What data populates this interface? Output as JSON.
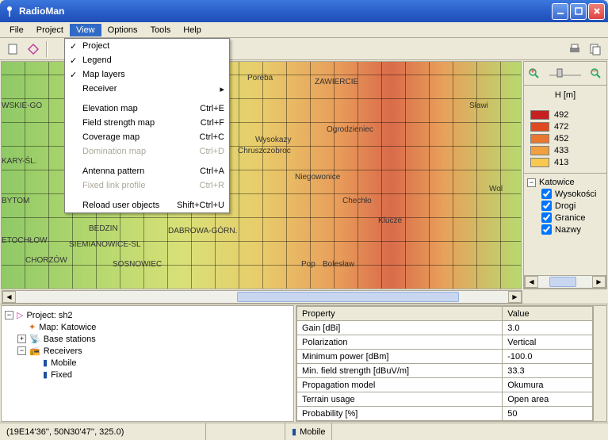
{
  "window": {
    "title": "RadioMan"
  },
  "menubar": {
    "file": "File",
    "project": "Project",
    "view": "View",
    "options": "Options",
    "tools": "Tools",
    "help": "Help"
  },
  "viewMenu": {
    "project": "Project",
    "legend": "Legend",
    "mapLayers": "Map layers",
    "receiver": "Receiver",
    "elevationMap": "Elevation map",
    "elevationMapKey": "Ctrl+E",
    "fieldStrength": "Field strength map",
    "fieldStrengthKey": "Ctrl+F",
    "coverage": "Coverage map",
    "coverageKey": "Ctrl+C",
    "domination": "Domination map",
    "dominationKey": "Ctrl+D",
    "antenna": "Antenna pattern",
    "antennaKey": "Ctrl+A",
    "fixedLink": "Fixed link profile",
    "fixedLinkKey": "Ctrl+R",
    "reload": "Reload user objects",
    "reloadKey": "Shift+Ctrl+U"
  },
  "map": {
    "labels": {
      "wskie": "WSKIE-GO",
      "kary": "KARY-ŚL.",
      "bytom": "BYTOM",
      "etochlow": "ETOCHŁOW",
      "chorzow": "CHORZÓW",
      "bedzin": "BEDZIN",
      "siemianowice": "SIEMIANOWICE-SL",
      "sosnowiec": "SOSNOWIEC",
      "dabrowa": "DABROWA-GÓRN.",
      "poreba": "Poreba",
      "zawiercie": "ZAWIERCIE",
      "ogrodzieniec": "Ogrodzieniec",
      "wysokazy": "Wysokazy",
      "chruszczobroc": "Chruszczobroc",
      "niegowonice": "Niegowonice",
      "chechlo": "Chechło",
      "klucze": "Klucze",
      "boleslaw": "Bolesław",
      "pop": "Pop",
      "wol": "Wol",
      "slawi": "Sławi"
    }
  },
  "legend": {
    "title": "H [m]",
    "items": [
      {
        "color": "#c62020",
        "value": "492"
      },
      {
        "color": "#e04a20",
        "value": "472"
      },
      {
        "color": "#e87830",
        "value": "452"
      },
      {
        "color": "#f0a040",
        "value": "433"
      },
      {
        "color": "#f8c850",
        "value": "413"
      }
    ]
  },
  "layerTree": {
    "root": "Katowice",
    "children": [
      {
        "label": "Wysokości",
        "checked": true
      },
      {
        "label": "Drogi",
        "checked": true
      },
      {
        "label": "Granice",
        "checked": true
      },
      {
        "label": "Nazwy",
        "checked": true
      }
    ]
  },
  "projectTree": {
    "root": "Project: sh2",
    "map": "Map: Katowice",
    "baseStations": "Base stations",
    "receivers": "Receivers",
    "mobile": "Mobile",
    "fixed": "Fixed"
  },
  "properties": {
    "headerProp": "Property",
    "headerVal": "Value",
    "rows": [
      {
        "prop": "Gain [dBi]",
        "val": "3.0"
      },
      {
        "prop": "Polarization",
        "val": "Vertical"
      },
      {
        "prop": "Minimum power [dBm]",
        "val": "-100.0"
      },
      {
        "prop": "Min. field strength [dBuV/m]",
        "val": "33.3"
      },
      {
        "prop": "Propagation model",
        "val": "Okumura"
      },
      {
        "prop": "Terrain usage",
        "val": "Open area"
      },
      {
        "prop": "Probability [%]",
        "val": "50"
      }
    ]
  },
  "statusbar": {
    "coords": "(19E14'36'', 50N30'47'', 325.0)",
    "receiver": "Mobile"
  },
  "icons": {
    "magPlus": "zoom-in-icon",
    "magMinus": "zoom-out-icon"
  }
}
